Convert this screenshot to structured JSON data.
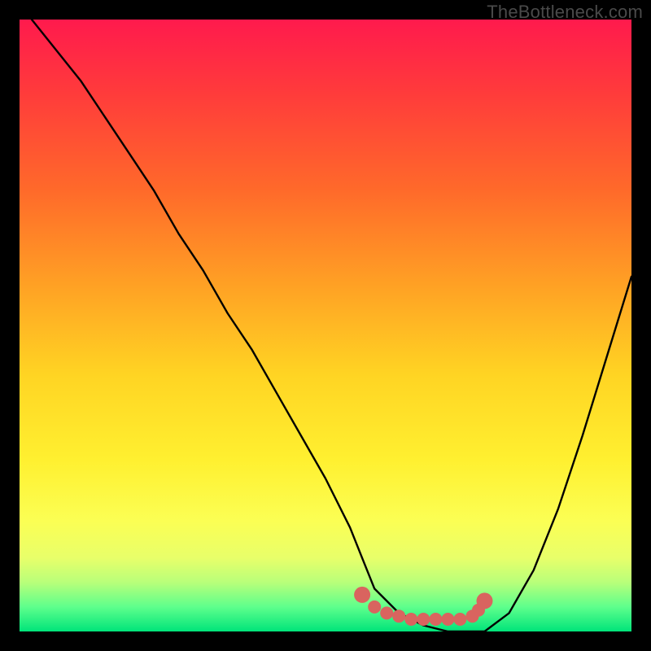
{
  "watermark": "TheBottleneck.com",
  "chart_data": {
    "type": "line",
    "title": "",
    "xlabel": "",
    "ylabel": "",
    "xlim": [
      0,
      100
    ],
    "ylim": [
      0,
      100
    ],
    "series": [
      {
        "name": "bottleneck-curve",
        "x": [
          2,
          6,
          10,
          14,
          18,
          22,
          26,
          30,
          34,
          38,
          42,
          46,
          50,
          54,
          56,
          58,
          62,
          66,
          70,
          74,
          76,
          80,
          84,
          88,
          92,
          96,
          100
        ],
        "y": [
          100,
          95,
          90,
          84,
          78,
          72,
          65,
          59,
          52,
          46,
          39,
          32,
          25,
          17,
          12,
          7,
          3,
          1,
          0,
          0,
          0,
          3,
          10,
          20,
          32,
          45,
          58
        ]
      }
    ],
    "highlight": {
      "name": "highlight-band",
      "type": "scatter",
      "points": [
        {
          "x": 56,
          "y": 6
        },
        {
          "x": 58,
          "y": 4
        },
        {
          "x": 60,
          "y": 3
        },
        {
          "x": 62,
          "y": 2.5
        },
        {
          "x": 64,
          "y": 2
        },
        {
          "x": 66,
          "y": 2
        },
        {
          "x": 68,
          "y": 2
        },
        {
          "x": 70,
          "y": 2
        },
        {
          "x": 72,
          "y": 2
        },
        {
          "x": 74,
          "y": 2.5
        },
        {
          "x": 75,
          "y": 3.5
        },
        {
          "x": 76,
          "y": 5
        }
      ],
      "color": "#d9645f"
    }
  }
}
